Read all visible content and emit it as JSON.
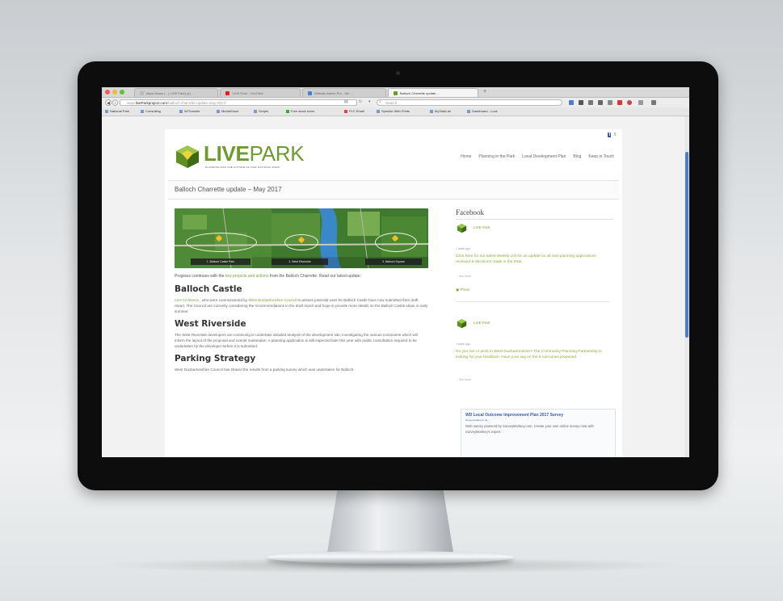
{
  "browser": {
    "tabs": [
      {
        "label": "https://www.t... ( LIVE Park) (s) ...",
        "active": false,
        "fav_color": "#bbbbbb"
      },
      {
        "label": "'LIVE Park' - YouTube",
        "active": false,
        "fav_color": "#e02020"
      },
      {
        "label": "Website Admin Pro - Die ...",
        "active": false,
        "fav_color": "#4a7fd0"
      },
      {
        "label": "Balloch Charrette update ...",
        "active": true,
        "fav_color": "#6d9b2e"
      }
    ],
    "new_tab": "+",
    "url_prefix": "www.",
    "url_domain": "liveParkproject.com",
    "url_path": "/balloch-charrette-update-may-2017/",
    "search_placeholder": "Search",
    "bookmarks": [
      "National Park",
      "Consulting",
      "W/Transfer",
      "MediaShout",
      "Scripts",
      "Free stock icons",
      "PLC Email",
      "Sprinkle Web Prints",
      "MyTaskList",
      "Dashboard - Lock"
    ]
  },
  "site": {
    "brand_bold": "LIVE",
    "brand_light": "PARK",
    "tagline": "PLANNING FOR THE FUTURE OF OUR NATIONAL PARK",
    "nav": [
      "Home",
      "Planning in the Park",
      "Local Development Plan",
      "Blog",
      "Keep in Touch"
    ],
    "social": [
      "f",
      "t"
    ],
    "page_title": "Balloch Charrette update – May 2017"
  },
  "banner": {
    "labels": [
      "1. Balloch Castle Park",
      "2. West Riverside",
      "3. Balloch Square"
    ]
  },
  "article": {
    "lead_before": "Progress continues with the ",
    "lead_link": "key projects and actions",
    "lead_after": " from the Balloch Charrette. Read our latest update:",
    "sections": [
      {
        "heading": "Balloch Castle",
        "link_a": "LDA Architects",
        "text_a": " , who were commissioned by ",
        "link_b": "West Dunbartonshire Council",
        "text_b": " to assess potential uses for Balloch Castle have now submitted their draft report. The Council are currently considering the recommendations in the draft report and hope to provide more details on the Balloch Castle ideas in early summer."
      },
      {
        "heading": "West Riverside",
        "text": "The West Riverside developers are continuing to undertake detailed analysis of the development site, investigating the various constraints which will inform the layout of the proposal and overall masterplan. A planning application is still expected later this year with public consultation required to be undertaken by the developer before it is submitted."
      },
      {
        "heading": "Parking Strategy",
        "text": "West Dunbartonshire Council has shared the results from a parking survey which was undertaken for Balloch"
      }
    ]
  },
  "sidebar": {
    "heading": "Facebook",
    "posts": [
      {
        "name": "LIVE Park",
        "time": "1 week ago",
        "text": "Click here for our latest Weekly List for an update on all new planning applications received & decisions made in the Park.",
        "more": "... See More",
        "photos": "Photo"
      },
      {
        "name": "LIVE Park",
        "time": "1 week ago",
        "text": "Do you live or work in West Dunbartonshire? The Community Planning Partnership is looking for your feedback. Have your say on the 5 outcomes proposed.",
        "more": "... See More"
      }
    ],
    "card": {
      "title": "WD Local Outcome Improvement Plan 2017 Survey",
      "subtitle": "surveymonkey.co.uk",
      "text": "Web survey powered by SurveyMonkey.com. Create your own online survey now with SurveyMonkey's expert"
    }
  }
}
